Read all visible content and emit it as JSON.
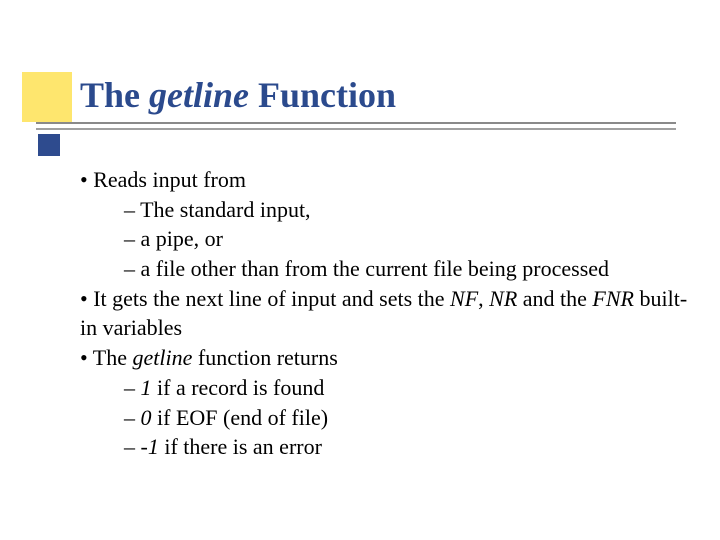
{
  "title": {
    "pre": "The ",
    "emph": "getline",
    "post": " Function"
  },
  "bullets": {
    "b1": "• Reads input from",
    "b1a": "– The standard input,",
    "b1b": "– a pipe, or",
    "b1c": "– a file other than from the current file being processed",
    "b2_pre": "• It gets the next line of input and sets the ",
    "b2_nf": "NF",
    "b2_mid1": ", ",
    "b2_nr": "NR",
    "b2_mid2": " and the ",
    "b2_fnr": "FNR",
    "b2_post": " built-in variables",
    "b3_pre": "• The ",
    "b3_emph": "getline",
    "b3_post": " function returns",
    "b3a_pre": "– ",
    "b3a_val": "1",
    "b3a_post": " if a record is found",
    "b3b_pre": "– ",
    "b3b_val": "0",
    "b3b_post": " if EOF (end of file)",
    "b3c_pre": "– ",
    "b3c_val": "-1",
    "b3c_post": " if there is an error"
  }
}
